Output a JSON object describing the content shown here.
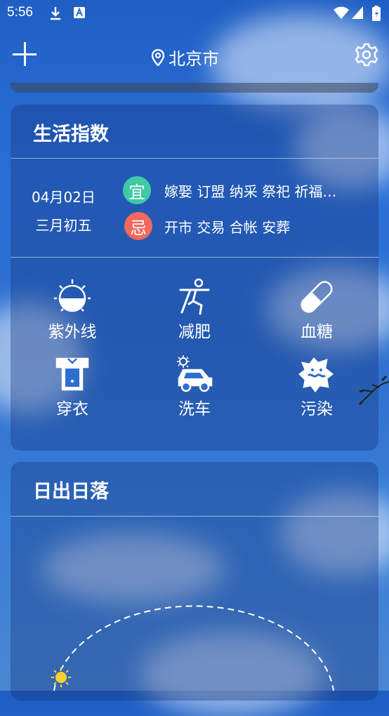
{
  "status_bar": {
    "time": "5:56"
  },
  "header": {
    "city": "北京市"
  },
  "life_index": {
    "title": "生活指数",
    "date": "04月02日",
    "lunar_date": "三月初五",
    "suitable_badge": "宜",
    "suitable": "嫁娶 订盟 纳采 祭祀 祈福…",
    "avoid_badge": "忌",
    "avoid": "开市 交易 合帐 安葬",
    "items": [
      {
        "label": "紫外线",
        "icon": "uv-icon"
      },
      {
        "label": "减肥",
        "icon": "exercise-icon"
      },
      {
        "label": "血糖",
        "icon": "pill-icon"
      },
      {
        "label": "穿衣",
        "icon": "clothes-icon"
      },
      {
        "label": "洗车",
        "icon": "car-wash-icon"
      },
      {
        "label": "污染",
        "icon": "pollution-icon"
      }
    ]
  },
  "sunrise_sunset": {
    "title": "日出日落"
  },
  "colors": {
    "suitable": "#3fc9a4",
    "avoid": "#f0685e"
  }
}
